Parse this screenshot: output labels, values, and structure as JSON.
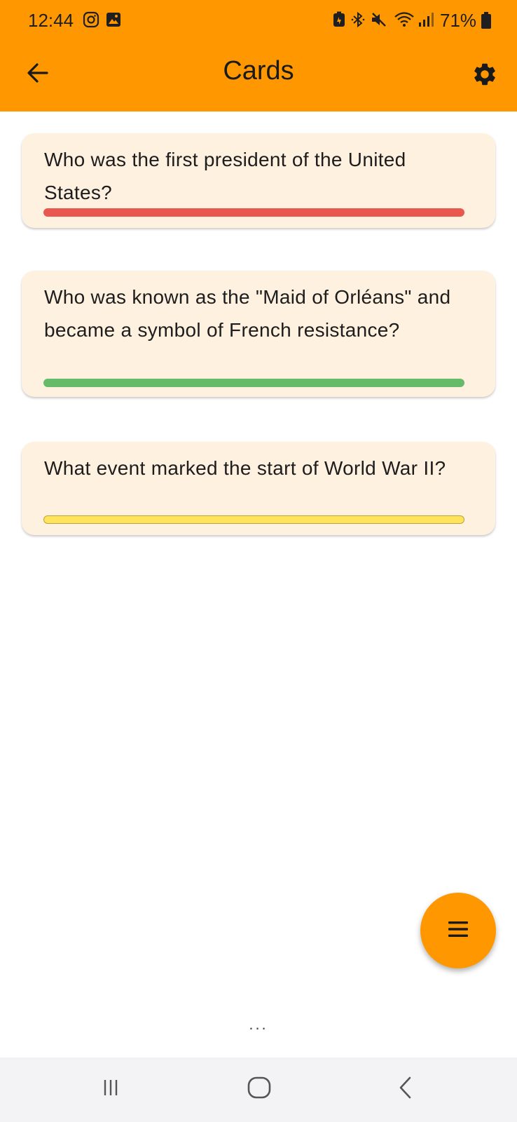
{
  "status_bar": {
    "time": "12:44",
    "battery_percent": "71%",
    "icons": [
      "instagram-icon",
      "gallery-icon",
      "battery-saver-icon",
      "bluetooth-icon",
      "mute-icon",
      "wifi-icon",
      "signal-icon",
      "battery-icon"
    ]
  },
  "toolbar": {
    "title": "Cards",
    "back_icon": "arrow-left-icon",
    "settings_icon": "gear-icon"
  },
  "cards": [
    {
      "question": "Who was the first president of the United States?",
      "bar_color": "#E8584E"
    },
    {
      "question": "Who was known as the \"Maid of Orléans\" and became a symbol of French resistance?",
      "bar_color": "#66BB6A"
    },
    {
      "question": "What event marked the start of World War II?",
      "bar_color": "#FFE45C"
    }
  ],
  "fab": {
    "icon": "menu-icon"
  },
  "pager_dots": "...",
  "colors": {
    "accent": "#FF9800",
    "card_background": "#FFF1E0",
    "nav_background": "#F3F3F5"
  },
  "nav": [
    "recents-icon",
    "home-icon",
    "back-icon"
  ]
}
